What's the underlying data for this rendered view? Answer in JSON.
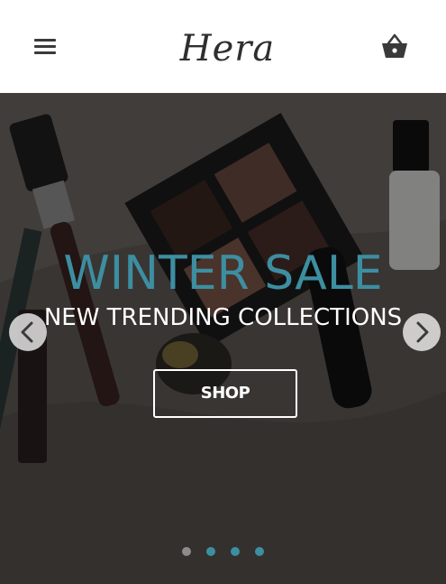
{
  "header": {
    "logo_text": "Hera",
    "menu_icon": "hamburger-menu-icon",
    "cart_icon": "shopping-basket-icon"
  },
  "hero": {
    "title": "WINTER SALE",
    "subtitle": "NEW TRENDING COLLECTIONS",
    "button_label": "SHOP",
    "prev_icon": "chevron-left-icon",
    "next_icon": "chevron-right-icon",
    "slide_count": 4,
    "active_slide": 2
  },
  "colors": {
    "accent": "#3d8ea1",
    "header_bg": "#ffffff",
    "overlay": "rgba(0,0,0,0.40)"
  }
}
